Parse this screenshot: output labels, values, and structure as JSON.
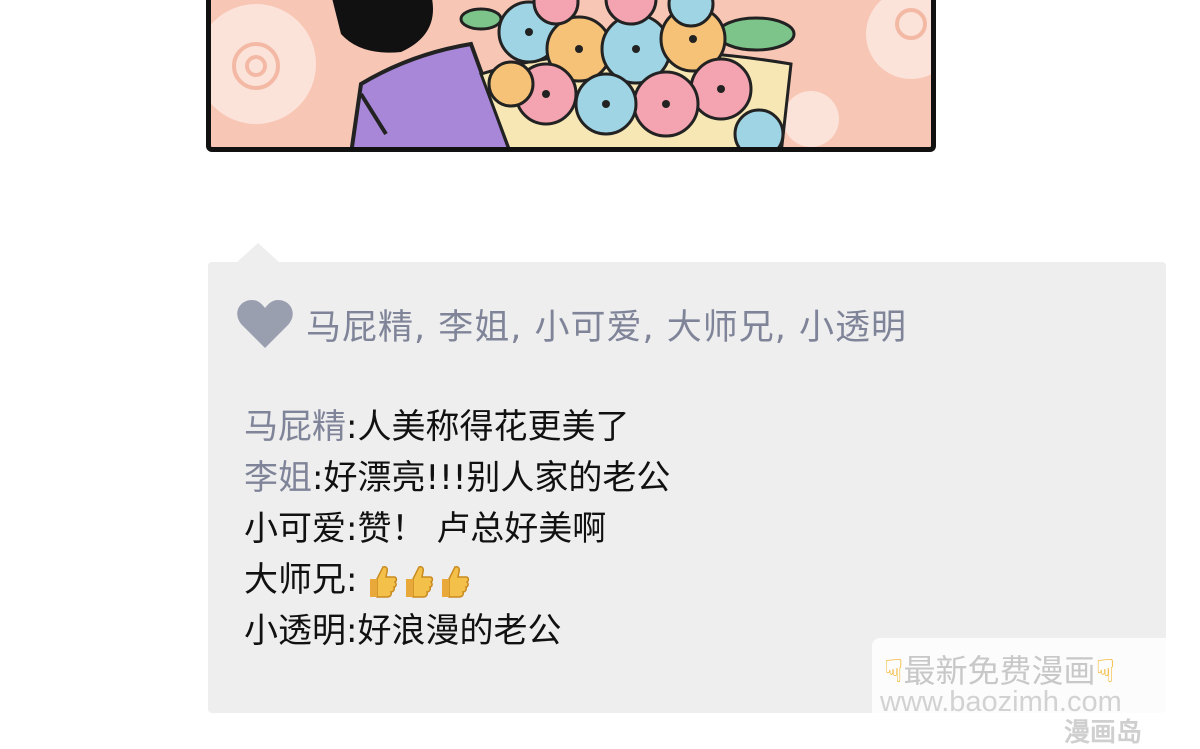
{
  "likes": {
    "names": "马屁精, 李姐, 小可爱, 大师兄, 小透明"
  },
  "comments": [
    {
      "author": "马屁精",
      "sep": ":",
      "text": "人美称得花更美了"
    },
    {
      "author": "李姐",
      "sep": ":",
      "text": "好漂亮!!!别人家的老公"
    },
    {
      "author": "小可爱",
      "sep": ":",
      "text": "赞！ 卢总好美啊"
    },
    {
      "author": "大师兄",
      "sep": ":",
      "text": ""
    },
    {
      "author": "小透明",
      "sep": ":",
      "text": "好浪漫的老公"
    }
  ],
  "watermark": {
    "title": "最新免费漫画",
    "url": "www.baozimh.com",
    "logo": "漫画岛"
  },
  "colors": {
    "card_bg": "#eeeeef",
    "name_gray": "#7f8498",
    "panel_bg": "#f8c6b4"
  }
}
